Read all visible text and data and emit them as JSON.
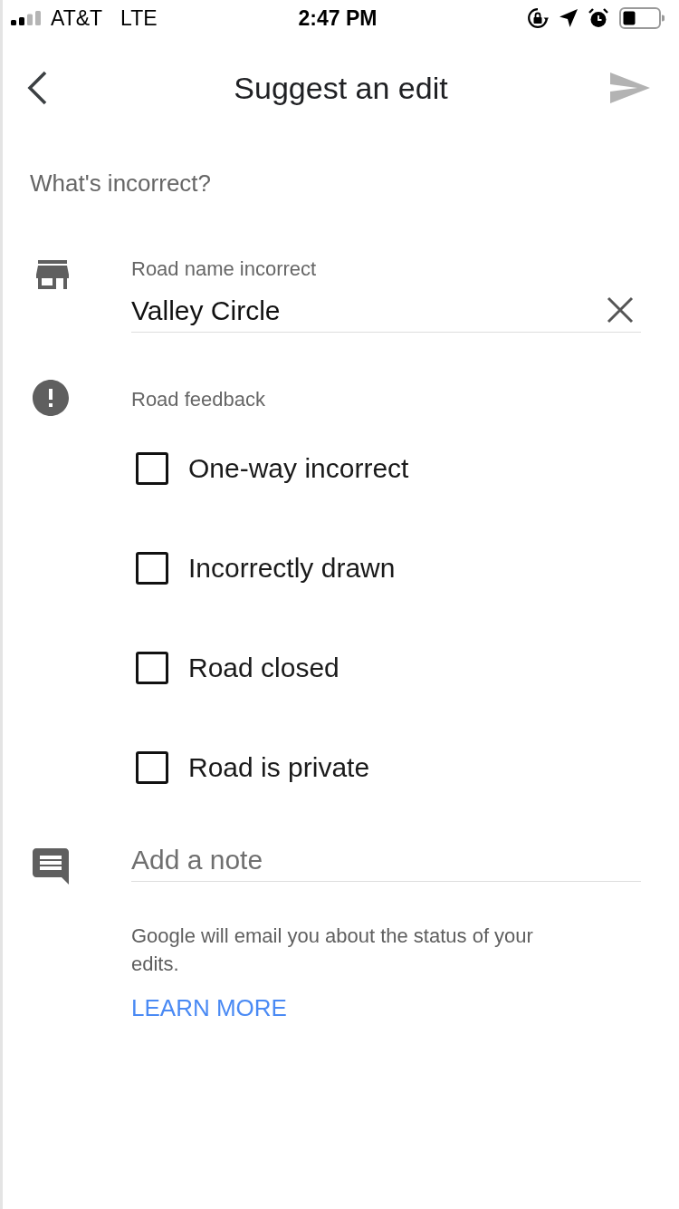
{
  "status_bar": {
    "carrier": "AT&T",
    "network": "LTE",
    "time": "2:47 PM"
  },
  "header": {
    "title": "Suggest an edit",
    "send_disabled": true
  },
  "section_title": "What's incorrect?",
  "road_name": {
    "label": "Road name incorrect",
    "value": "Valley Circle"
  },
  "road_feedback": {
    "label": "Road feedback",
    "options": [
      {
        "label": "One-way incorrect",
        "checked": false
      },
      {
        "label": "Incorrectly drawn",
        "checked": false
      },
      {
        "label": "Road closed",
        "checked": false
      },
      {
        "label": "Road is private",
        "checked": false
      }
    ]
  },
  "note": {
    "placeholder": "Add a note"
  },
  "info": {
    "text": "Google will email you about the status of your edits.",
    "link": "LEARN MORE"
  }
}
